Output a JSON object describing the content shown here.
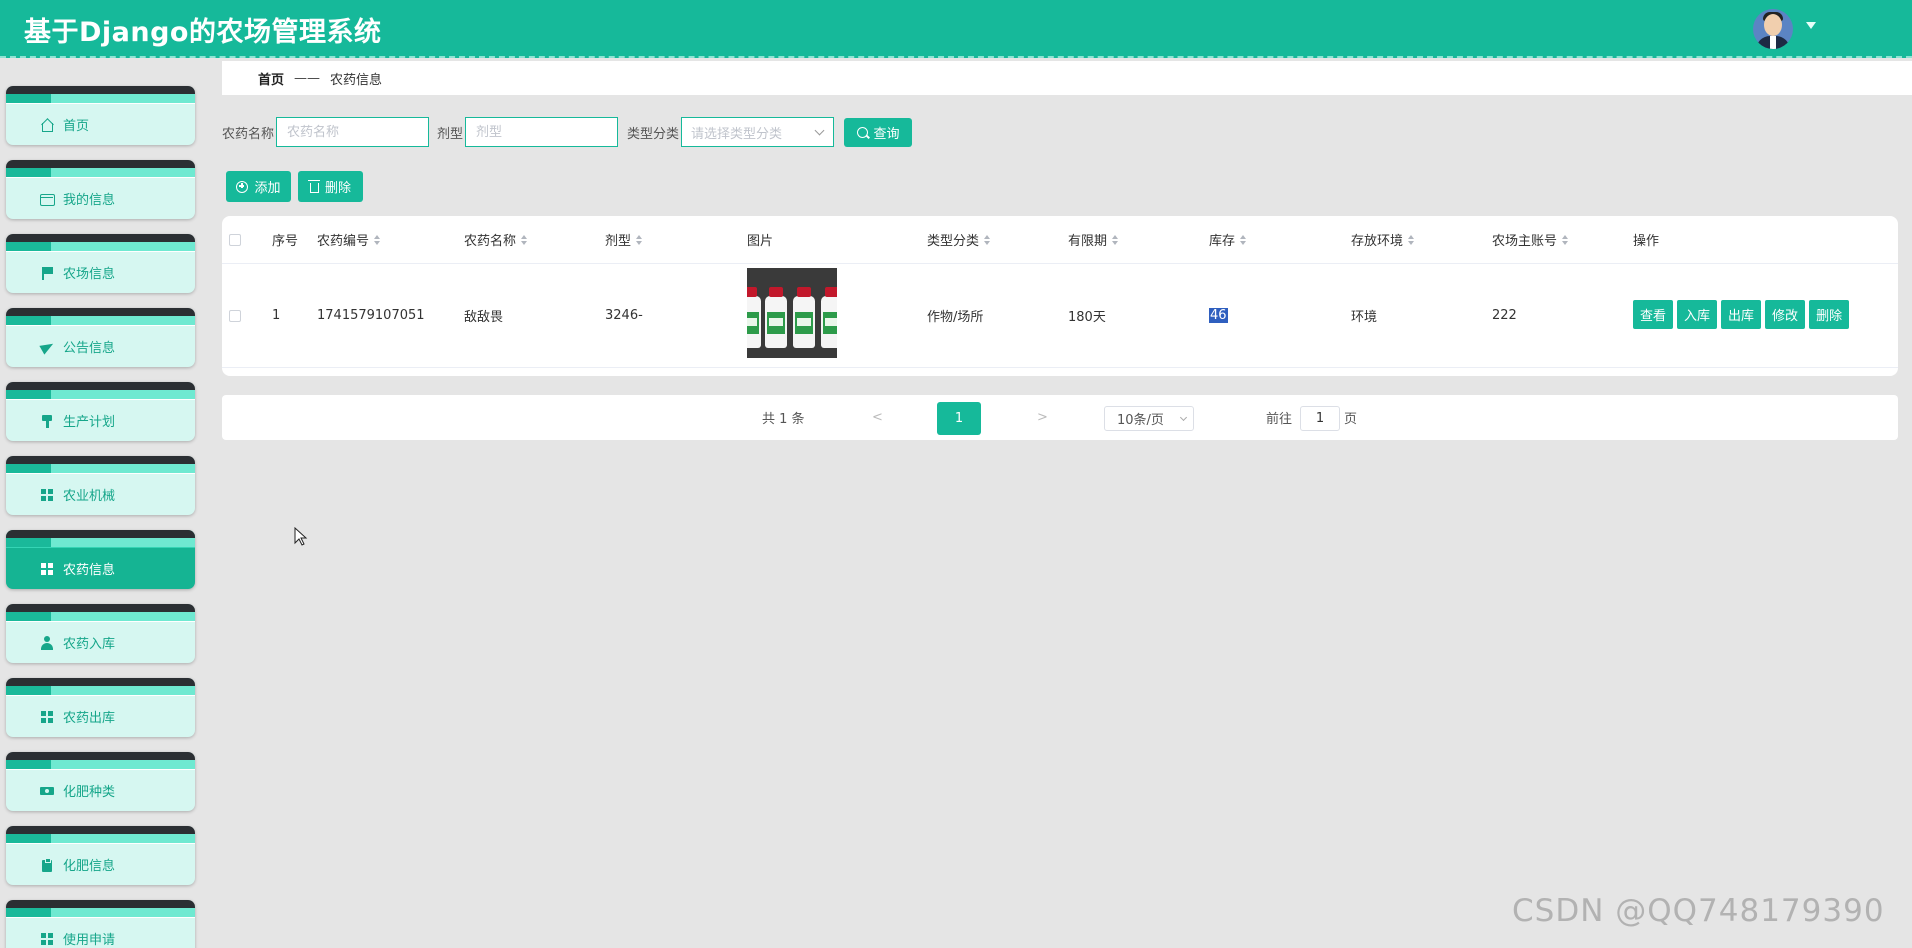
{
  "app": {
    "title": "基于Django的农场管理系统"
  },
  "sidebar": {
    "items": [
      {
        "label": "首页",
        "icon": "home-icon"
      },
      {
        "label": "我的信息",
        "icon": "card-icon"
      },
      {
        "label": "农场信息",
        "icon": "flag-icon"
      },
      {
        "label": "公告信息",
        "icon": "send-icon"
      },
      {
        "label": "生产计划",
        "icon": "brush-icon"
      },
      {
        "label": "农业机械",
        "icon": "grid-icon"
      },
      {
        "label": "农药信息",
        "icon": "grid-icon",
        "active": true
      },
      {
        "label": "农药入库",
        "icon": "user-icon"
      },
      {
        "label": "农药出库",
        "icon": "grid-icon"
      },
      {
        "label": "化肥种类",
        "icon": "ticket-icon"
      },
      {
        "label": "化肥信息",
        "icon": "clipboard-icon"
      },
      {
        "label": "使用申请",
        "icon": "grid-icon"
      }
    ]
  },
  "breadcrumb": {
    "home": "首页",
    "separator": "——",
    "current": "农药信息"
  },
  "search": {
    "name_label": "农药名称",
    "name_placeholder": "农药名称",
    "form_label": "剂型",
    "form_placeholder": "剂型",
    "category_label": "类型分类",
    "category_placeholder": "请选择类型分类",
    "query_button": "查询"
  },
  "actions": {
    "add": "添加",
    "delete": "删除"
  },
  "table": {
    "columns": [
      "序号",
      "农药编号",
      "农药名称",
      "剂型",
      "图片",
      "类型分类",
      "有限期",
      "库存",
      "存放环境",
      "农场主账号",
      "操作"
    ],
    "rows": [
      {
        "index": "1",
        "code": "1741579107051",
        "name": "敌敌畏",
        "form": "3246-",
        "category": "作物/场所",
        "validity": "180天",
        "stock": "46",
        "environment": "环境",
        "owner": "222",
        "ops": [
          "查看",
          "入库",
          "出库",
          "修改",
          "删除"
        ]
      }
    ]
  },
  "pagination": {
    "total": "共 1 条",
    "prev": "<",
    "current": "1",
    "next": ">",
    "page_size": "10条/页",
    "goto_label": "前往",
    "goto_value": "1",
    "page_unit": "页"
  },
  "watermark": "CSDN @QQ748179390",
  "colors": {
    "primary": "#16b99a",
    "menu_bg": "#d6f7f1",
    "highlight": "#2f5fbf"
  }
}
